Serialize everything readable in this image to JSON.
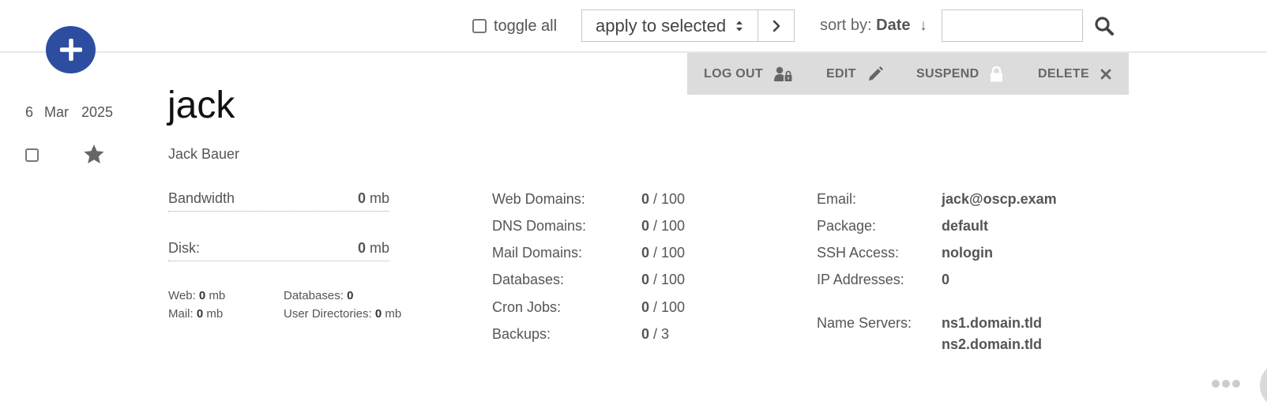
{
  "toolbar": {
    "toggle_all": "toggle all",
    "apply_select": "apply to selected",
    "sort_prefix": "sort by:",
    "sort_value": "Date",
    "sort_arrow": "↓",
    "search_placeholder": ""
  },
  "actions": {
    "logout": "LOG OUT",
    "edit": "EDIT",
    "suspend": "SUSPEND",
    "delete": "DELETE"
  },
  "user": {
    "day": "6",
    "month": "Mar",
    "year": "2025",
    "username": "jack",
    "full_name": "Jack Bauer"
  },
  "usage": {
    "bandwidth_label": "Bandwidth",
    "bandwidth_value": "0",
    "bandwidth_unit": "mb",
    "disk_label": "Disk:",
    "disk_value": "0",
    "disk_unit": "mb",
    "web_label": "Web:",
    "web_value": "0",
    "web_unit": "mb",
    "mail_label": "Mail:",
    "mail_value": "0",
    "mail_unit": "mb",
    "databases_label": "Databases:",
    "databases_value": "0",
    "userdirs_label": "User Directories:",
    "userdirs_value": "0",
    "userdirs_unit": "mb"
  },
  "stats": [
    {
      "label": "Web Domains:",
      "used": "0",
      "limit": "/ 100"
    },
    {
      "label": "DNS Domains:",
      "used": "0",
      "limit": "/ 100"
    },
    {
      "label": "Mail Domains:",
      "used": "0",
      "limit": "/ 100"
    },
    {
      "label": "Databases:",
      "used": "0",
      "limit": "/ 100"
    },
    {
      "label": "Cron Jobs:",
      "used": "0",
      "limit": "/ 100"
    },
    {
      "label": "Backups:",
      "used": "0",
      "limit": "/ 3"
    }
  ],
  "props": {
    "email_label": "Email:",
    "email_value": "jack@oscp.exam",
    "package_label": "Package:",
    "package_value": "default",
    "ssh_label": "SSH Access:",
    "ssh_value": "nologin",
    "ip_label": "IP Addresses:",
    "ip_value": "0",
    "ns_label": "Name Servers:",
    "ns1": "ns1.domain.tld",
    "ns2": "ns2.domain.tld"
  },
  "colors": {
    "accent": "#2d4ea0",
    "action_bar": "#dcdcdc"
  },
  "icons": {
    "add": "plus-icon",
    "search": "search-icon",
    "logout": "user-lock-icon",
    "edit": "pencil-icon",
    "suspend": "lock-icon",
    "delete": "close-icon",
    "favorite": "star-icon"
  }
}
